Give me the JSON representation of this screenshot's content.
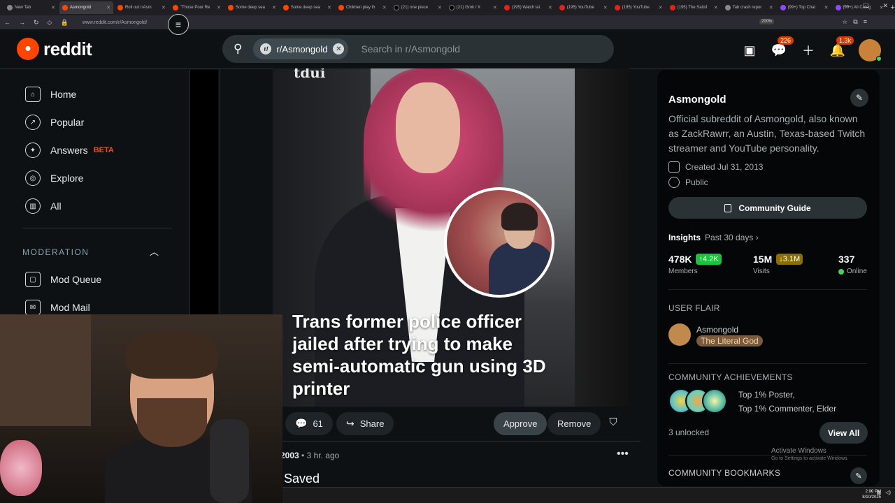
{
  "browser": {
    "tabs": [
      {
        "label": "New Tab",
        "icon": "g"
      },
      {
        "label": "Asmongold",
        "icon": "reddit",
        "active": true
      },
      {
        "label": "Roll out r/Asm",
        "icon": "reddit"
      },
      {
        "label": "\"Those Poor Re",
        "icon": "reddit"
      },
      {
        "label": "Some deep sea",
        "icon": "reddit"
      },
      {
        "label": "Some deep sea",
        "icon": "reddit"
      },
      {
        "label": "Children play th",
        "icon": "reddit"
      },
      {
        "label": "(21) one piece",
        "icon": "x"
      },
      {
        "label": "(21) Grok / X",
        "icon": "x"
      },
      {
        "label": "(195) Watch lat",
        "icon": "yt"
      },
      {
        "label": "(195) YouTube",
        "icon": "yt"
      },
      {
        "label": "(195) YouTube",
        "icon": "yt"
      },
      {
        "label": "(195) The Satisf",
        "icon": "yt"
      },
      {
        "label": "Tab crash repor",
        "icon": "g"
      },
      {
        "label": "(99+) Top Chat",
        "icon": "tw"
      },
      {
        "label": "(99+) All Categ",
        "icon": "tw"
      }
    ],
    "new_tab": "+",
    "url": "www.reddit.com/r/Asmongold/",
    "zoom": "200%"
  },
  "header": {
    "logo_text": "reddit",
    "search_chip": "r/Asmongold",
    "search_placeholder": "Search in r/Asmongold",
    "chat_badge": "226",
    "notif_badge": "1.3k"
  },
  "left_nav": {
    "items": [
      {
        "label": "Home",
        "icon": "home-icon"
      },
      {
        "label": "Popular",
        "icon": "popular-icon"
      },
      {
        "label": "Answers",
        "icon": "answers-icon"
      },
      {
        "label": "Explore",
        "icon": "explore-icon"
      },
      {
        "label": "All",
        "icon": "all-icon"
      }
    ],
    "beta": "BETA",
    "moderation_heading": "MODERATION",
    "mod_items": [
      {
        "label": "Mod Queue",
        "icon": "mod-queue-icon"
      },
      {
        "label": "Mod Mail",
        "icon": "mod-mail-icon"
      }
    ]
  },
  "post": {
    "image_logo": "tdui",
    "headline": "Trans former police officer jailed after trying to make semi-automatic gun using 3D printer",
    "comments": "61",
    "share": "Share",
    "approve": "Approve",
    "remove": "Remove",
    "meta_user": "2003",
    "meta_time": "3 hr. ago",
    "saved": "Saved"
  },
  "community": {
    "name": "Asmongold",
    "description": "Official subreddit of Asmongold, also known as ZackRawrr, an Austin, Texas-based Twitch streamer and YouTube personality.",
    "created": "Created Jul 31, 2013",
    "visibility": "Public",
    "guide_button": "Community Guide",
    "insights_label": "Insights",
    "insights_range": "Past 30 days ›",
    "stats": {
      "members": "478K",
      "members_change": "↑4.2K",
      "members_label": "Members",
      "visits": "15M",
      "visits_change": "↓3.1M",
      "visits_label": "Visits",
      "online": "337",
      "online_label": "Online"
    },
    "user_flair_heading": "USER FLAIR",
    "flair_user": "Asmongold",
    "flair_tag": "The Literal God",
    "achievements_heading": "COMMUNITY ACHIEVEMENTS",
    "achievements_line1": "Top 1% Poster,",
    "achievements_line2": "Top 1% Commenter, Elder",
    "unlocked": "3 unlocked",
    "view_all": "View All",
    "bookmarks_heading": "COMMUNITY BOOKMARKS"
  },
  "os": {
    "activate_title": "Activate Windows",
    "activate_sub": "Go to Settings to activate Windows.",
    "clock_time": "2:00 PM",
    "clock_date": "8/10/2025"
  },
  "colors": {
    "accent": "#ff4500",
    "up_badge": "#19c43a",
    "down_badge": "#8b6d00",
    "online": "#46d160"
  }
}
